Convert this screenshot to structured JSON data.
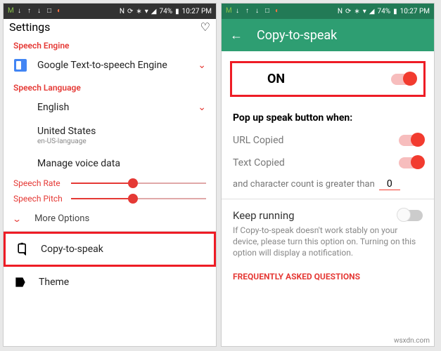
{
  "status": {
    "left_icons": [
      "M",
      "↓",
      "↑",
      "↓",
      "□",
      "◐"
    ],
    "right_text": "74%",
    "nfc": "N",
    "time": "10:27 PM"
  },
  "left": {
    "title": "Settings",
    "sections": {
      "speech_engine": {
        "header": "Speech Engine",
        "item": "Google Text-to-speech Engine"
      },
      "speech_language": {
        "header": "Speech Language",
        "language": "English",
        "region": "United States",
        "region_sub": "en-US-language",
        "manage": "Manage voice data"
      },
      "speech_rate": {
        "label": "Speech Rate",
        "value": 0.42
      },
      "speech_pitch": {
        "label": "Speech Pitch",
        "value": 0.42
      },
      "more_options": "More Options",
      "copy_to_speak": "Copy-to-speak",
      "theme": "Theme"
    }
  },
  "right": {
    "appbar_title": "Copy-to-speak",
    "on_label": "ON",
    "popup_header": "Pop up speak button when:",
    "url_copied": "URL Copied",
    "text_copied": "Text Copied",
    "char_count_label": "and character count is greater than",
    "char_count_value": "0",
    "keep_running": "Keep running",
    "keep_desc": "If Copy-to-speak doesn't work stably on your device, please turn this option on.\nTurning on this option will display a notification.",
    "faq": "FREQUENTLY ASKED QUESTIONS"
  },
  "watermark": "wsxdn.com"
}
